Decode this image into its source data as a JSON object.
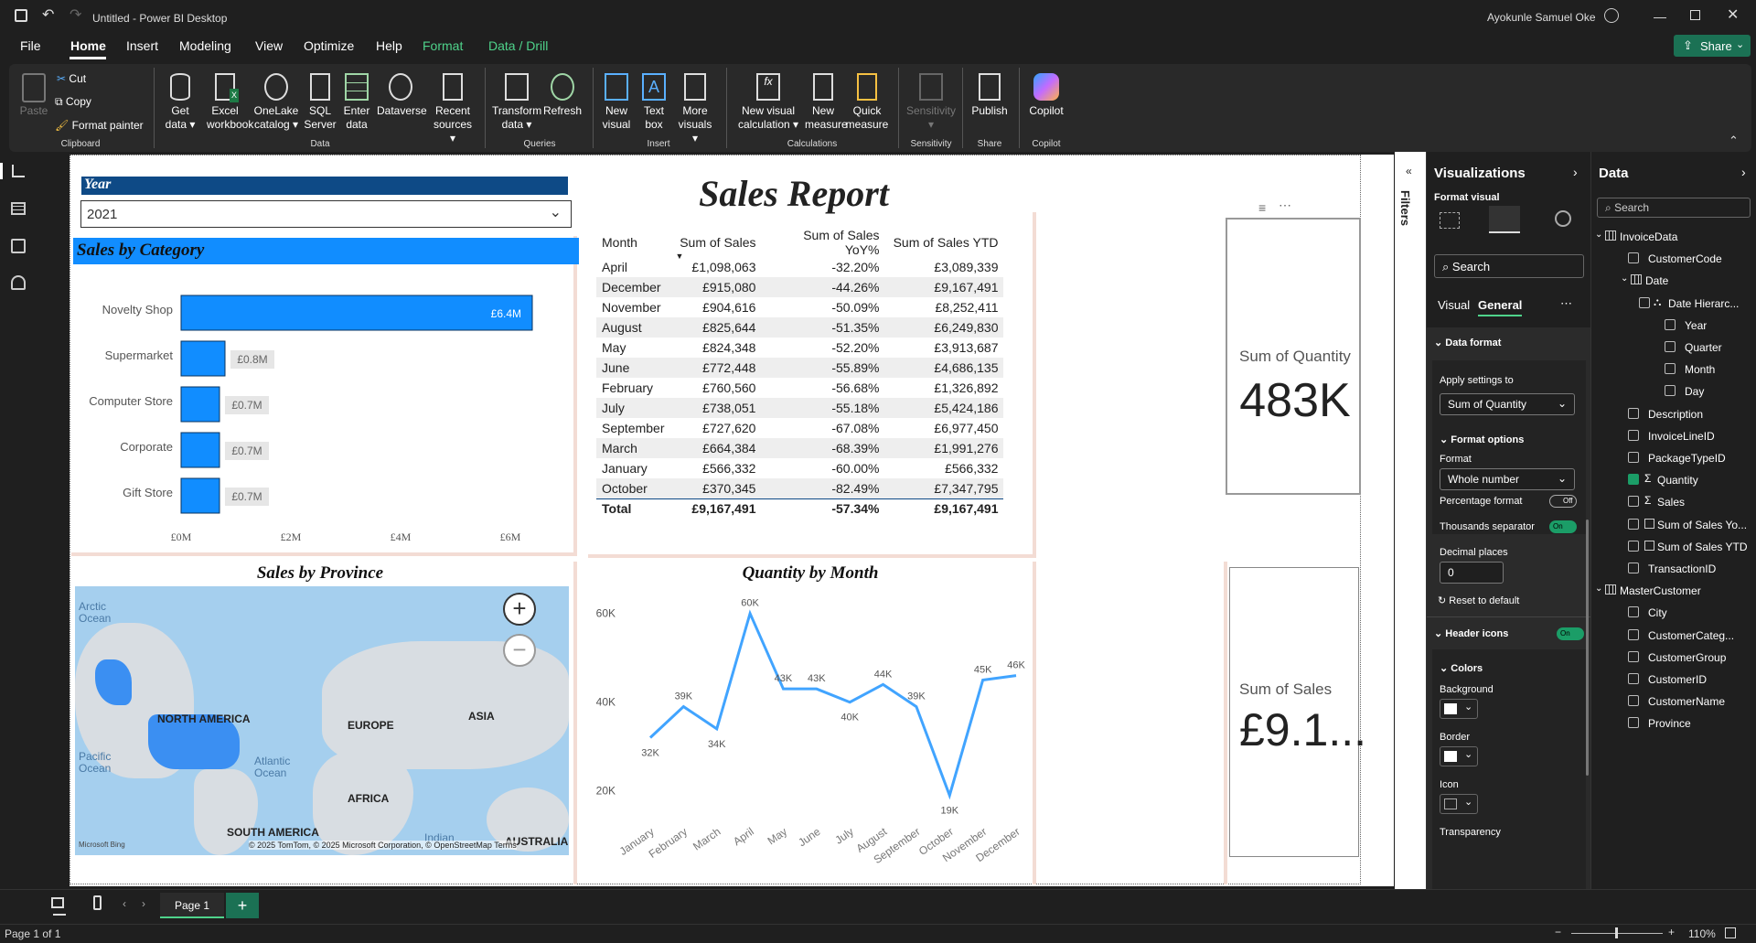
{
  "title": {
    "app": "Untitled - Power BI Desktop",
    "user": "Ayokunle Samuel Oke",
    "share": "Share"
  },
  "menu": [
    "File",
    "Home",
    "Insert",
    "Modeling",
    "View",
    "Optimize",
    "Help",
    "Format",
    "Data / Drill"
  ],
  "ribbon": {
    "clipboard": {
      "paste": "Paste",
      "cut": "Cut",
      "copy": "Copy",
      "painter": "Format painter",
      "group": "Clipboard"
    },
    "data": {
      "items": [
        [
          "Get",
          "data ▾"
        ],
        [
          "Excel",
          "workbook"
        ],
        [
          "OneLake",
          "catalog ▾"
        ],
        [
          "SQL",
          "Server"
        ],
        [
          "Enter",
          "data"
        ],
        [
          "Dataverse",
          ""
        ],
        [
          "Recent",
          "sources ▾"
        ]
      ],
      "group": "Data"
    },
    "queries": {
      "items": [
        [
          "Transform",
          "data ▾"
        ],
        [
          "Refresh",
          ""
        ]
      ],
      "group": "Queries"
    },
    "insert": {
      "items": [
        [
          "New",
          "visual"
        ],
        [
          "Text",
          "box"
        ],
        [
          "More",
          "visuals ▾"
        ]
      ],
      "group": "Insert"
    },
    "calc": {
      "items": [
        [
          "New visual",
          "calculation ▾"
        ],
        [
          "New",
          "measure"
        ],
        [
          "Quick",
          "measure"
        ]
      ],
      "group": "Calculations"
    },
    "sens": {
      "items": [
        [
          "Sensitivity",
          "▾"
        ]
      ],
      "group": "Sensitivity"
    },
    "share": {
      "items": [
        [
          "Publish",
          ""
        ]
      ],
      "group": "Share"
    },
    "copilot": {
      "items": [
        [
          "Copilot",
          ""
        ]
      ],
      "group": "Copilot"
    }
  },
  "report": {
    "title": "Sales Report",
    "slicer": {
      "label": "Year",
      "value": "2021"
    },
    "cat": {
      "title": "Sales by Category",
      "ticks": [
        "£0M",
        "£2M",
        "£4M",
        "£6M"
      ]
    },
    "province": {
      "title": "Sales by Province",
      "labels": [
        "Arctic\nOcean",
        "NORTH AMERICA",
        "EUROPE",
        "ASIA",
        "Pacific\nOcean",
        "Atlantic\nOcean",
        "AFRICA",
        "SOUTH AMERICA",
        "Indian",
        "AUSTRALIA"
      ],
      "credit": "© 2025 TomTom, © 2025 Microsoft Corporation, © OpenStreetMap Terms",
      "bing": "Microsoft Bing"
    },
    "qty": {
      "title": "Quantity by Month"
    },
    "card1": {
      "label": "Sum of Quantity",
      "value": "483K"
    },
    "card2": {
      "label": "Sum of Sales",
      "value": "£9.1..."
    },
    "table": {
      "headers": [
        "Month",
        "Sum of Sales",
        "Sum of Sales YoY%",
        "Sum of Sales YTD"
      ],
      "rows": [
        [
          "April",
          "£1,098,063",
          "-32.20%",
          "£3,089,339"
        ],
        [
          "December",
          "£915,080",
          "-44.26%",
          "£9,167,491"
        ],
        [
          "November",
          "£904,616",
          "-50.09%",
          "£8,252,411"
        ],
        [
          "August",
          "£825,644",
          "-51.35%",
          "£6,249,830"
        ],
        [
          "May",
          "£824,348",
          "-52.20%",
          "£3,913,687"
        ],
        [
          "June",
          "£772,448",
          "-55.89%",
          "£4,686,135"
        ],
        [
          "February",
          "£760,560",
          "-56.68%",
          "£1,326,892"
        ],
        [
          "July",
          "£738,051",
          "-55.18%",
          "£5,424,186"
        ],
        [
          "September",
          "£727,620",
          "-67.08%",
          "£6,977,450"
        ],
        [
          "March",
          "£664,384",
          "-68.39%",
          "£1,991,276"
        ],
        [
          "January",
          "£566,332",
          "-60.00%",
          "£566,332"
        ],
        [
          "October",
          "£370,345",
          "-82.49%",
          "£7,347,795"
        ]
      ],
      "total": [
        "Total",
        "£9,167,491",
        "-57.34%",
        "£9,167,491"
      ]
    }
  },
  "chart_data": [
    {
      "type": "bar",
      "title": "Sales by Category",
      "categories": [
        "Novelty Shop",
        "Supermarket",
        "Computer Store",
        "Corporate",
        "Gift Store"
      ],
      "values": [
        6.4,
        0.8,
        0.7,
        0.7,
        0.7
      ],
      "labels": [
        "£6.4M",
        "£0.8M",
        "£0.7M",
        "£0.7M",
        "£0.7M"
      ],
      "xlim": [
        0,
        7
      ],
      "ticks": [
        "£0M",
        "£2M",
        "£4M",
        "£6M"
      ],
      "color": "#118dff"
    },
    {
      "type": "line",
      "title": "Quantity by Month",
      "categories": [
        "January",
        "February",
        "March",
        "April",
        "May",
        "June",
        "July",
        "August",
        "September",
        "October",
        "November",
        "December"
      ],
      "values": [
        32,
        39,
        34,
        60,
        43,
        43,
        40,
        44,
        39,
        19,
        45,
        46
      ],
      "labels": [
        "32K",
        "39K",
        "34K",
        "60K",
        "43K",
        "43K",
        "40K",
        "44K",
        "39K",
        "19K",
        "45K",
        "46K"
      ],
      "ylim": [
        15,
        62
      ],
      "yticks": [
        "20K",
        "40K",
        "60K"
      ],
      "color": "#41a4ff"
    }
  ],
  "filters": {
    "label": "Filters"
  },
  "viz": {
    "title": "Visualizations",
    "format_visual": "Format visual",
    "search": "Search",
    "tabs": [
      "Visual",
      "General"
    ],
    "data_format": "Data format",
    "apply_to": "Apply settings to",
    "apply_value": "Sum of Quantity",
    "format_options": "Format options",
    "format": "Format",
    "format_value": "Whole number",
    "pct": "Percentage format",
    "pct_state": "Off",
    "thousands": "Thousands separator",
    "thousands_state": "On",
    "decimals": "Decimal places",
    "decimals_value": "0",
    "reset": "Reset to default",
    "header_icons": "Header icons",
    "header_state": "On",
    "colors": "Colors",
    "background": "Background",
    "border": "Border",
    "icon": "Icon",
    "transparency": "Transparency"
  },
  "datapane": {
    "title": "Data",
    "search": "Search",
    "items": [
      {
        "t": "InvoiceData",
        "lvl": 0,
        "k": "table"
      },
      {
        "t": "CustomerCode",
        "lvl": 1
      },
      {
        "t": "Date",
        "lvl": 1,
        "k": "table"
      },
      {
        "t": "Date Hierarc...",
        "lvl": 2,
        "k": "hier"
      },
      {
        "t": "Year",
        "lvl": 3
      },
      {
        "t": "Quarter",
        "lvl": 3
      },
      {
        "t": "Month",
        "lvl": 3
      },
      {
        "t": "Day",
        "lvl": 3
      },
      {
        "t": "Description",
        "lvl": 1
      },
      {
        "t": "InvoiceLineID",
        "lvl": 1
      },
      {
        "t": "PackageTypeID",
        "lvl": 1
      },
      {
        "t": "Quantity",
        "lvl": 1,
        "k": "sum",
        "checked": true
      },
      {
        "t": "Sales",
        "lvl": 1,
        "k": "sum"
      },
      {
        "t": "Sum of Sales Yo...",
        "lvl": 1,
        "k": "calc"
      },
      {
        "t": "Sum of Sales YTD",
        "lvl": 1,
        "k": "calc"
      },
      {
        "t": "TransactionID",
        "lvl": 1
      },
      {
        "t": "MasterCustomer",
        "lvl": 0,
        "k": "table"
      },
      {
        "t": "City",
        "lvl": 1
      },
      {
        "t": "CustomerCateg...",
        "lvl": 1
      },
      {
        "t": "CustomerGroup",
        "lvl": 1
      },
      {
        "t": "CustomerID",
        "lvl": 1
      },
      {
        "t": "CustomerName",
        "lvl": 1
      },
      {
        "t": "Province",
        "lvl": 1
      }
    ]
  },
  "tabs": {
    "page": "Page 1"
  },
  "status": {
    "page": "Page 1 of 1",
    "zoom": "110%"
  }
}
